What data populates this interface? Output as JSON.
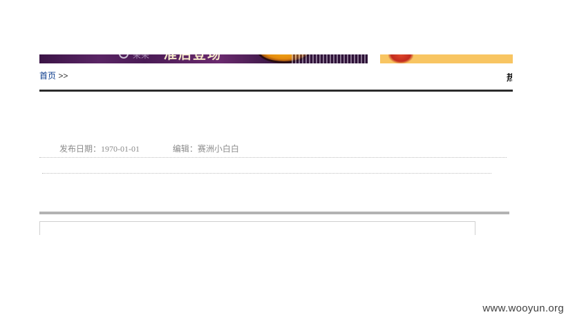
{
  "banner": {
    "left_headline": "准后登场",
    "left_sub": "采采"
  },
  "breadcrumb": {
    "home": "首页",
    "separator": " >>"
  },
  "sidebar": {
    "hot_label": "热"
  },
  "article": {
    "date_label": "发布日期：",
    "date_value": "1970-01-01",
    "editor_label": "编辑：",
    "editor_value": "赛洲小白白"
  },
  "watermark": "www.wooyun.org",
  "colors": {
    "link": "#0b3b8c",
    "banner_purple": "#4a1b55",
    "banner_yellow": "#f8c562",
    "meta_text": "#8a8a8a"
  }
}
